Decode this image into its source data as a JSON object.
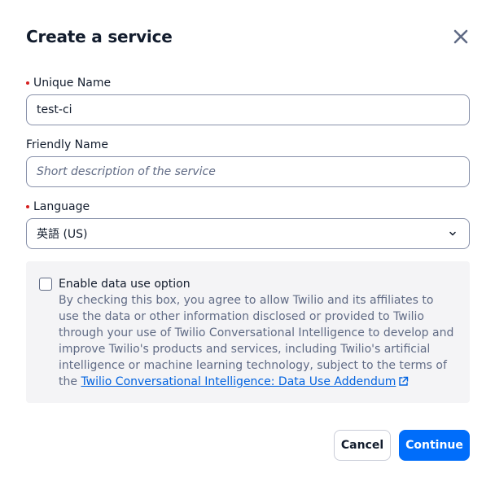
{
  "dialog": {
    "title": "Create a service",
    "close_icon": "close-icon"
  },
  "fields": {
    "unique_name": {
      "label": "Unique Name",
      "value": "test-ci",
      "required": true
    },
    "friendly_name": {
      "label": "Friendly Name",
      "value": "",
      "placeholder": "Short description of the service",
      "required": false
    },
    "language": {
      "label": "Language",
      "selected": "英語 (US)",
      "required": true,
      "icon": "chevron-down-icon"
    }
  },
  "consent": {
    "checked": false,
    "title": "Enable data use option",
    "text": "By checking this box, you agree to allow Twilio and its affiliates to use the data or other information disclosed or provided to Twilio through your use of Twilio Conversational Intelligence to develop and improve Twilio's products and services, including Twilio's artificial intelligence or machine learning technology, subject to the terms of the ",
    "link_label": "Twilio Conversational Intelligence: Data Use Addendum",
    "link_icon": "external-link-icon"
  },
  "buttons": {
    "cancel": "Cancel",
    "continue": "Continue"
  },
  "colors": {
    "primary": "#006dfa",
    "link": "#0263e0",
    "required": "#d61f1f",
    "panel": "#f4f4f6"
  }
}
